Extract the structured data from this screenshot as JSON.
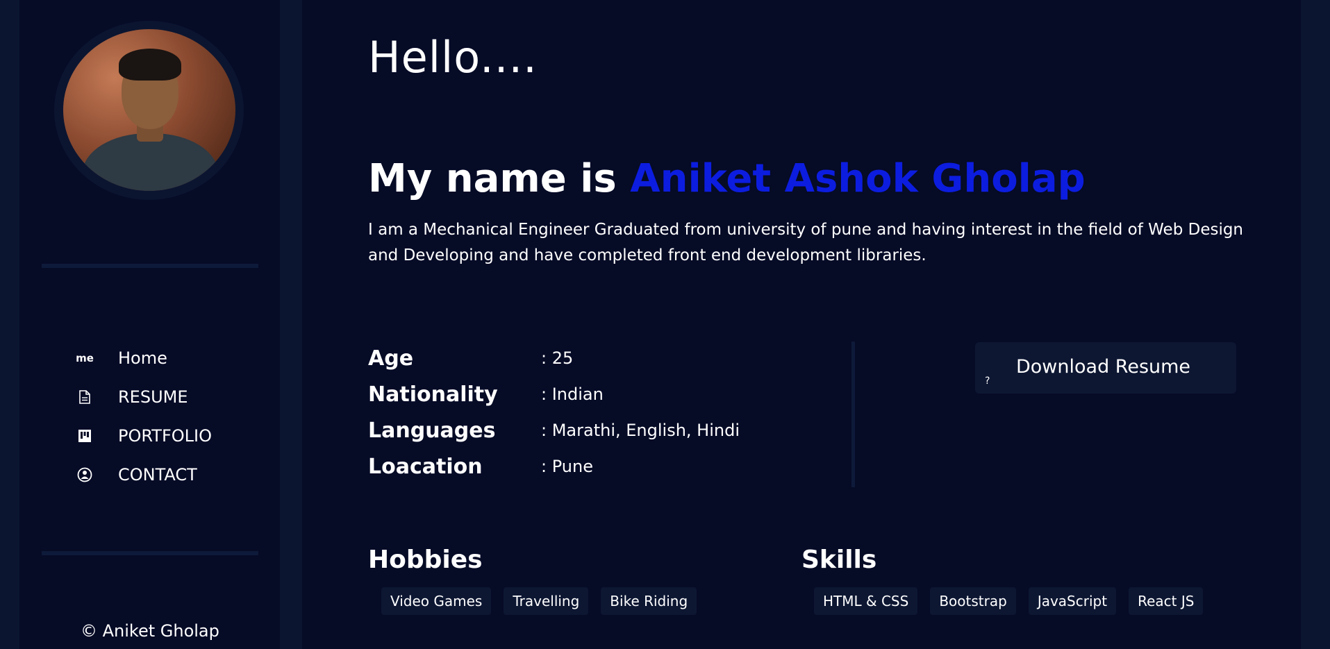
{
  "sidebar": {
    "avatar_alt": "Profile photo",
    "nav": [
      {
        "icon": "me",
        "label": "Home"
      },
      {
        "icon": "document-icon",
        "label": "RESUME"
      },
      {
        "icon": "portfolio-icon",
        "label": "PORTFOLIO"
      },
      {
        "icon": "contact-icon",
        "label": "CONTACT"
      }
    ],
    "copyright": "© Aniket Gholap"
  },
  "main": {
    "greeting": "Hello....",
    "name_prefix": "My name is ",
    "name": "Aniket Ashok Gholap",
    "intro": "I am a Mechanical Engineer Graduated from university of pune and having interest in the field of Web Design and Developing and have completed front end development libraries.",
    "info": [
      {
        "label": "Age",
        "value": ": 25"
      },
      {
        "label": "Nationality",
        "value": ": Indian"
      },
      {
        "label": "Languages",
        "value": ": Marathi, English, Hindi"
      },
      {
        "label": "Loacation",
        "value": ": Pune"
      }
    ],
    "download_button": {
      "label": "Download Resume",
      "icon_text": "?"
    },
    "hobbies": {
      "title": "Hobbies",
      "items": [
        "Video Games",
        "Travelling",
        "Bike Riding"
      ]
    },
    "skills": {
      "title": "Skills",
      "items": [
        "HTML & CSS",
        "Bootstrap",
        "JavaScript",
        "React JS"
      ]
    }
  },
  "colors": {
    "background": "#060b26",
    "accent": "#0c1de0",
    "panel": "#0d1732"
  }
}
